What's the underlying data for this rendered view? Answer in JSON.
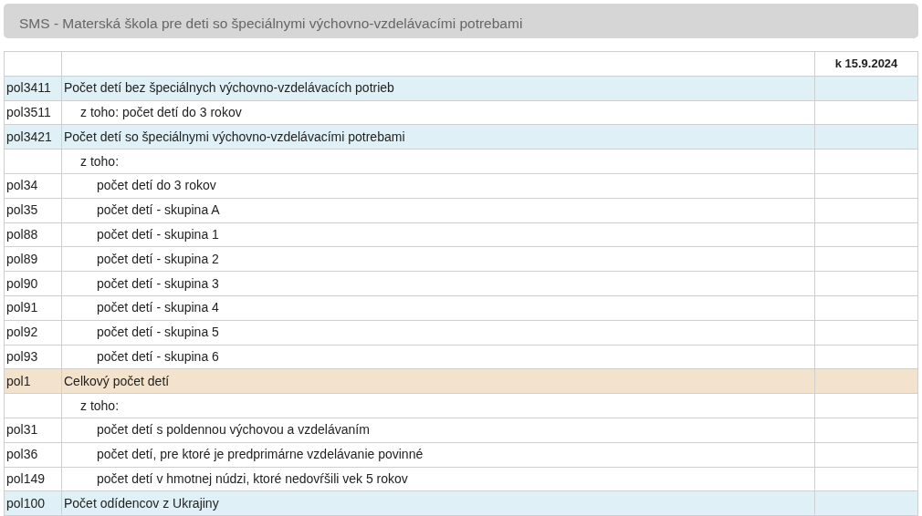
{
  "header": {
    "title": "SMS - Materská škola pre deti so špeciálnymi výchovno-vzdelávacími potrebami"
  },
  "table": {
    "columns": [
      "k 15.9.2024"
    ],
    "rows": [
      {
        "code": "pol3411",
        "label": "Počet detí bez špeciálnych výchovno-vzdelávacích potrieb",
        "kind": "group",
        "children": [
          {
            "code": "pol3511",
            "label": "z toho: počet detí do 3 rokov"
          }
        ]
      },
      {
        "code": "pol3421",
        "label": "Počet detí so špeciálnymi výchovno-vzdelávacími potrebami",
        "kind": "group",
        "children": [
          {
            "label": "z toho:",
            "children": [
              {
                "code": "pol34",
                "label": "počet detí do 3 rokov"
              },
              {
                "code": "pol35",
                "label": "počet detí - skupina A"
              },
              {
                "code": "pol88",
                "label": "počet detí - skupina 1"
              },
              {
                "code": "pol89",
                "label": "počet detí - skupina 2"
              },
              {
                "code": "pol90",
                "label": "počet detí - skupina 3"
              },
              {
                "code": "pol91",
                "label": "počet detí - skupina 4"
              },
              {
                "code": "pol92",
                "label": "počet detí - skupina 5"
              },
              {
                "code": "pol93",
                "label": "počet detí - skupina 6"
              }
            ]
          }
        ]
      },
      {
        "code": "pol1",
        "label": "Celkový počet detí",
        "kind": "total",
        "children": [
          {
            "label": "z toho:",
            "children": [
              {
                "code": "pol31",
                "label": "počet detí s poldennou výchovou a vzdelávaním"
              },
              {
                "code": "pol36",
                "label": "počet detí, pre ktoré je predprimárne vzdelávanie povinné"
              },
              {
                "code": "pol149",
                "label": "počet detí v hmotnej núdzi, ktoré nedovŕšili vek 5 rokov"
              }
            ]
          }
        ]
      },
      {
        "code": "pol100",
        "label": "Počet odídencov z Ukrajiny",
        "kind": "group"
      }
    ]
  }
}
